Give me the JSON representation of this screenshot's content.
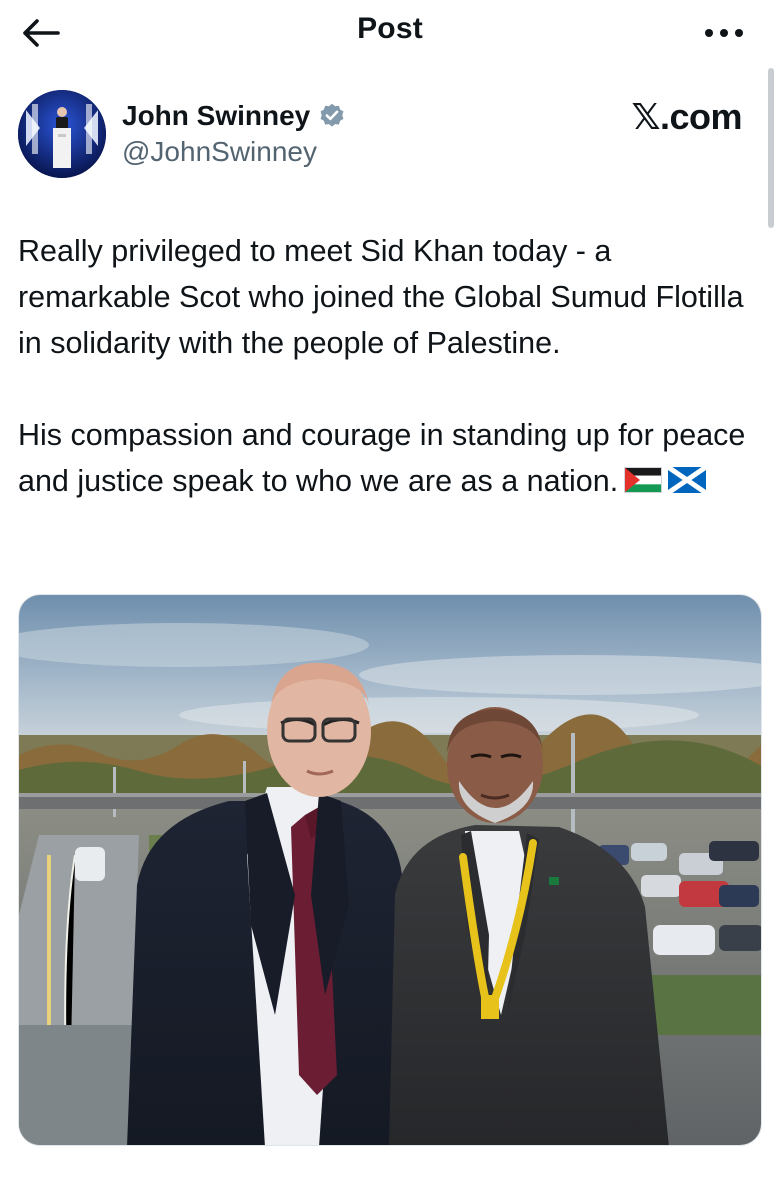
{
  "topbar": {
    "title": "Post",
    "back_icon": "arrow-left-icon",
    "more_icon": "more-horizontal-icon"
  },
  "author": {
    "name": "John Swinney",
    "handle": "@JohnSwinney",
    "verified_icon": "verified-badge-icon",
    "verified_color": "#829aab"
  },
  "brand": {
    "label": "𝕏.com"
  },
  "post": {
    "paragraph_1": "Really privileged to meet Sid Khan today - a remarkable Scot who joined the Global Sumud Flotilla in solidarity with the people of Palestine.",
    "paragraph_2": "His compassion and courage in standing up for peace and justice speak to who we are as a nation.",
    "emoji": [
      "palestine-flag-icon",
      "scotland-flag-icon"
    ]
  },
  "colors": {
    "text": "#0f1419",
    "secondary": "#536471"
  }
}
